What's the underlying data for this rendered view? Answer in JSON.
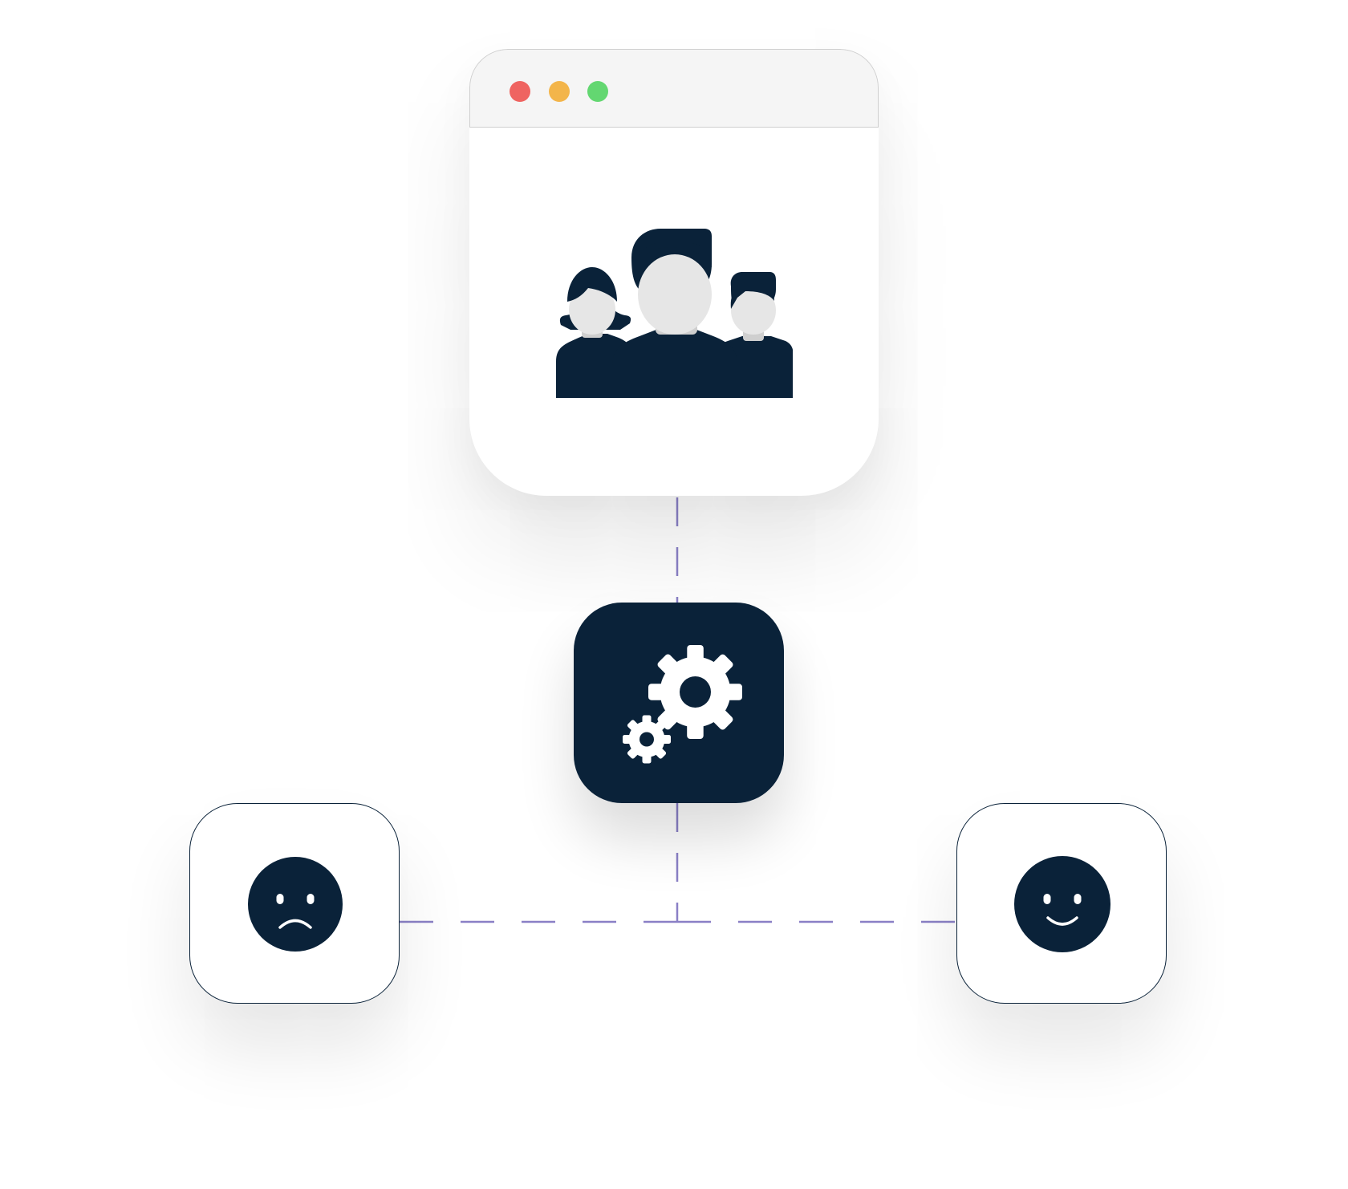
{
  "colors": {
    "navy": "#0a2239",
    "connector": "#8a80c6",
    "window_close": "#ef6461",
    "window_minimize": "#f3b54a",
    "window_maximize": "#63d771",
    "titlebar": "#f5f5f5",
    "face_skin": "#e6e6e6",
    "neck_shadow": "#cfcfcf"
  },
  "browser_window": {
    "controls": [
      "close",
      "minimize",
      "maximize"
    ],
    "content_icon": "team-icon"
  },
  "process_node": {
    "icon": "gears-icon"
  },
  "outcomes": [
    {
      "kind": "negative",
      "icon": "sad-face-icon"
    },
    {
      "kind": "positive",
      "icon": "happy-face-icon"
    }
  ],
  "connectors": {
    "style": "dashed"
  }
}
